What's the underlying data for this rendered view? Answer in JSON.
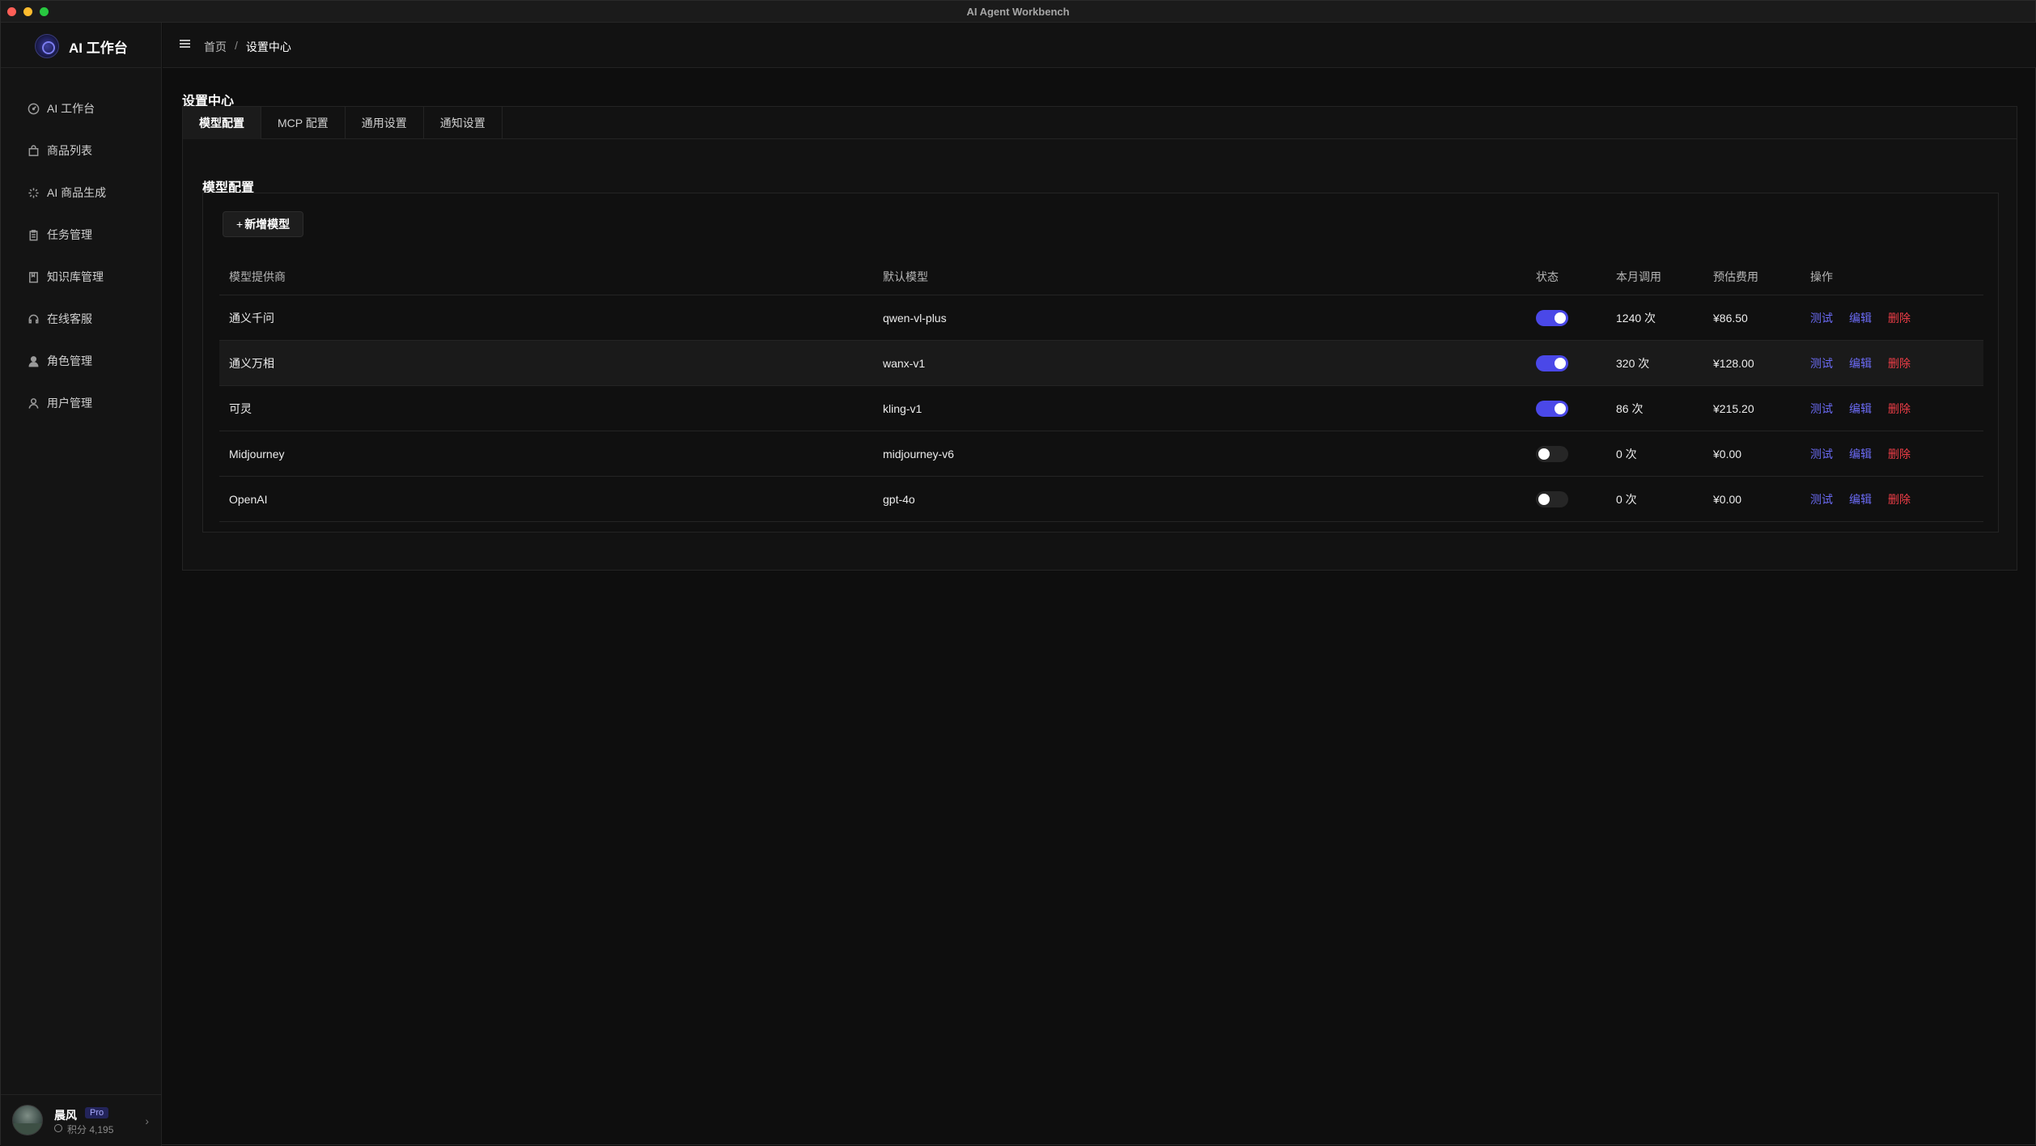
{
  "window": {
    "title": "AI Agent Workbench"
  },
  "brand": {
    "title": "AI 工作台"
  },
  "sidebar": {
    "items": [
      {
        "label": "AI 工作台",
        "icon": "dashboard-icon"
      },
      {
        "label": "商品列表",
        "icon": "shopping-bag-icon"
      },
      {
        "label": "AI 商品生成",
        "icon": "sparkles-icon"
      },
      {
        "label": "任务管理",
        "icon": "clipboard-icon"
      },
      {
        "label": "知识库管理",
        "icon": "book-icon"
      },
      {
        "label": "在线客服",
        "icon": "headset-icon"
      },
      {
        "label": "角色管理",
        "icon": "user-filled-icon"
      },
      {
        "label": "用户管理",
        "icon": "user-outline-icon"
      }
    ]
  },
  "user": {
    "name": "晨风",
    "badge": "Pro",
    "points": "积分 4,195"
  },
  "breadcrumb": {
    "home": "首页",
    "separator": "/",
    "current": "设置中心"
  },
  "page": {
    "title": "设置中心"
  },
  "tabs": [
    {
      "label": "模型配置",
      "active": true
    },
    {
      "label": "MCP 配置",
      "active": false
    },
    {
      "label": "通用设置",
      "active": false
    },
    {
      "label": "通知设置",
      "active": false
    }
  ],
  "section": {
    "title": "模型配置",
    "add_button": "新增模型",
    "add_plus": "+"
  },
  "table": {
    "headers": {
      "provider": "模型提供商",
      "model": "默认模型",
      "status": "状态",
      "calls": "本月调用",
      "cost": "预估费用",
      "actions": "操作"
    },
    "actions": {
      "test": "测试",
      "edit": "编辑",
      "delete": "删除"
    },
    "rows": [
      {
        "provider": "通义千问",
        "model": "qwen-vl-plus",
        "enabled": true,
        "calls": "1240 次",
        "cost": "¥86.50"
      },
      {
        "provider": "通义万相",
        "model": "wanx-v1",
        "enabled": true,
        "calls": "320 次",
        "cost": "¥128.00"
      },
      {
        "provider": "可灵",
        "model": "kling-v1",
        "enabled": true,
        "calls": "86 次",
        "cost": "¥215.20"
      },
      {
        "provider": "Midjourney",
        "model": "midjourney-v6",
        "enabled": false,
        "calls": "0 次",
        "cost": "¥0.00"
      },
      {
        "provider": "OpenAI",
        "model": "gpt-4o",
        "enabled": false,
        "calls": "0 次",
        "cost": "¥0.00"
      }
    ]
  },
  "colors": {
    "accent": "#4a48e8",
    "link": "#6b6bf5",
    "danger": "#ee3d47",
    "background": "#0e0e0e"
  }
}
